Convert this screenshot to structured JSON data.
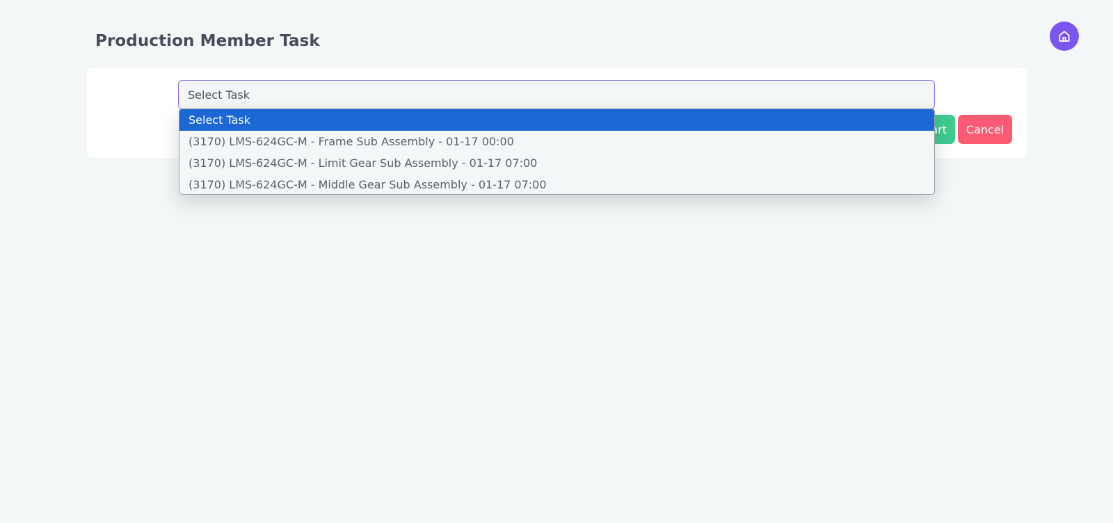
{
  "page": {
    "title": "Production Member Task"
  },
  "header": {
    "home_icon": "home-icon"
  },
  "form": {
    "task_select": {
      "value": "Select Task",
      "options": [
        "Select Task",
        "(3170) LMS-624GC-M - Frame Sub Assembly - 01-17 00:00",
        "(3170) LMS-624GC-M - Limit Gear Sub Assembly - 01-17 07:00",
        "(3170) LMS-624GC-M - Middle Gear Sub Assembly - 01-17 07:00"
      ],
      "highlighted_index": 0
    },
    "start_label": "art",
    "cancel_label": "Cancel"
  },
  "colors": {
    "accent": "#7a55ee",
    "start": "#3ecb8f",
    "cancel": "#fb5a73",
    "highlight": "#1b68d4",
    "background": "#f4f7f8"
  }
}
